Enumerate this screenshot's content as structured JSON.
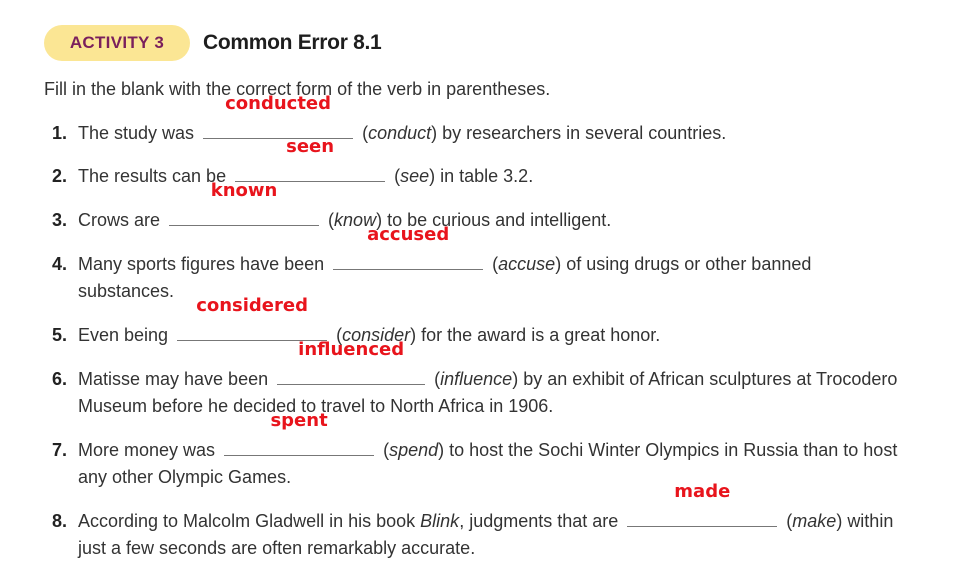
{
  "activity": {
    "badge": "ACTIVITY 3",
    "title": "Common Error 8.1"
  },
  "instructions": "Fill in the blank with the correct form of the verb in parentheses.",
  "items": [
    {
      "num": "1.",
      "before": "The study was",
      "answer": "conducted",
      "verb": "conduct",
      "after": "by researchers in several countries."
    },
    {
      "num": "2.",
      "before": "The results can be",
      "answer": "seen",
      "verb": "see",
      "after": "in table 3.2."
    },
    {
      "num": "3.",
      "before": "Crows are",
      "answer": "known",
      "verb": "know",
      "after": "to be curious and intelligent."
    },
    {
      "num": "4.",
      "before": "Many sports figures have been",
      "answer": "accused",
      "verb": "accuse",
      "after": "of using drugs or other banned",
      "after2": "substances."
    },
    {
      "num": "5.",
      "before": "Even being",
      "answer": "considered",
      "verb": "consider",
      "after": "for the award is a great honor."
    },
    {
      "num": "6.",
      "before": "Matisse may have been",
      "answer": "influenced",
      "verb": "influence",
      "after": "by an exhibit of African sculptures at Trocodero",
      "after2": "Museum before he decided to travel to North Africa in 1906."
    },
    {
      "num": "7.",
      "before": "More money was",
      "answer": "spent",
      "verb": "spend",
      "after": "to host the Sochi Winter Olympics in Russia than to host",
      "after2": "any other Olympic Games."
    },
    {
      "num": "8.",
      "before": "According to Malcolm Gladwell in his book",
      "book": "Blink",
      "before2": ", judgments that are",
      "answer": "made",
      "verb": "make",
      "after": "within",
      "after2": "just a few seconds are often remarkably accurate."
    }
  ]
}
